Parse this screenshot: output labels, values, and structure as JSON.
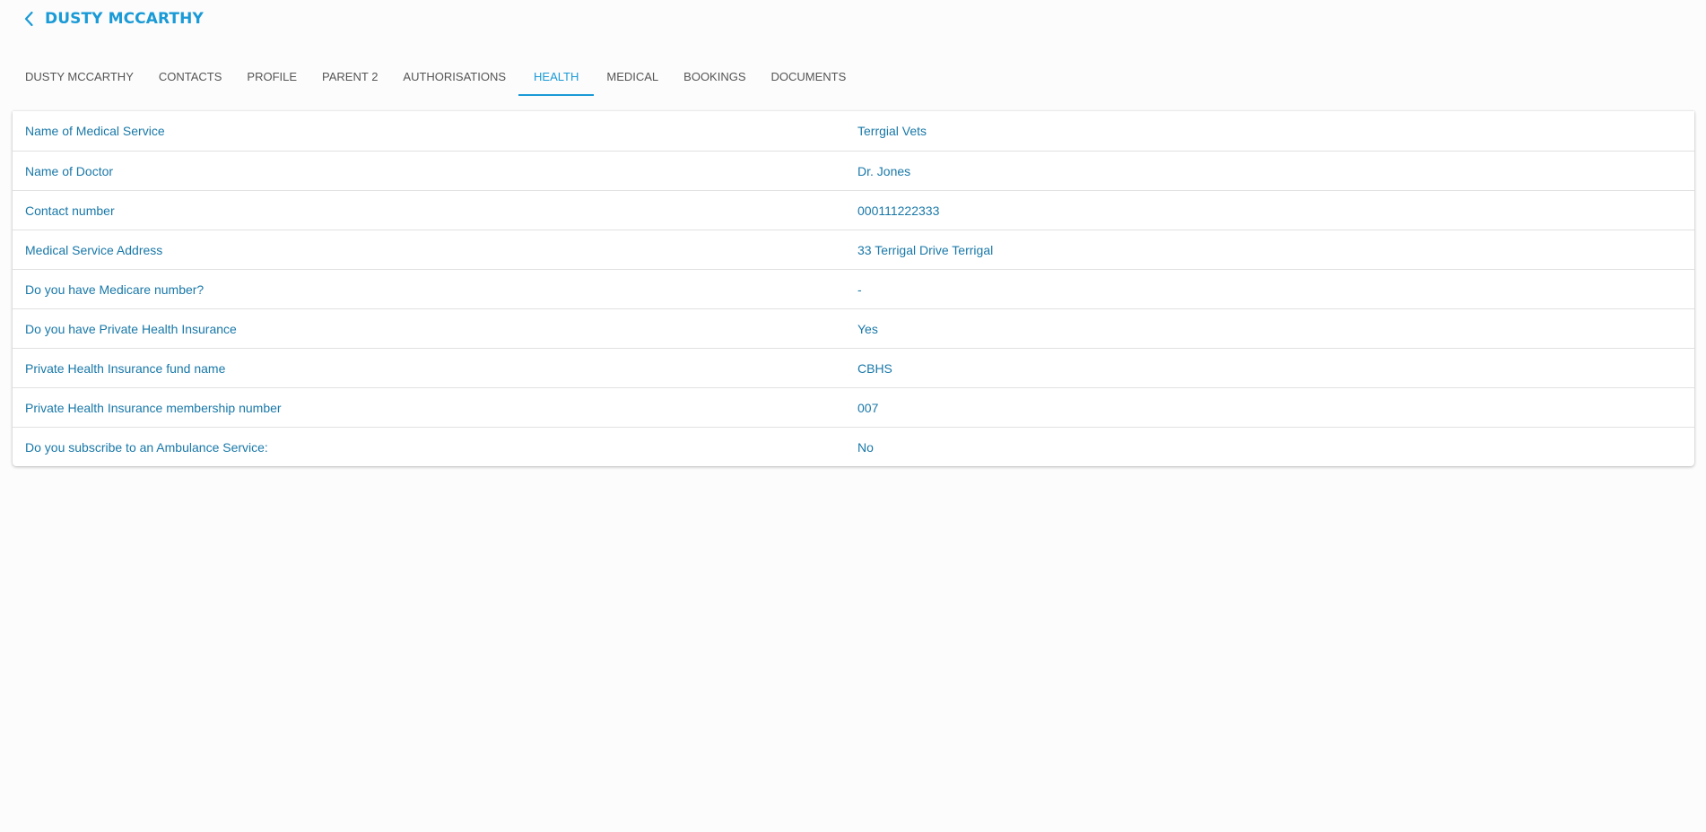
{
  "header": {
    "back_icon": "chevron-left-icon",
    "title": "DUSTY MCCARTHY"
  },
  "tabs": [
    {
      "label": "DUSTY MCCARTHY",
      "active": false
    },
    {
      "label": "CONTACTS",
      "active": false
    },
    {
      "label": "PROFILE",
      "active": false
    },
    {
      "label": "PARENT 2",
      "active": false
    },
    {
      "label": "AUTHORISATIONS",
      "active": false
    },
    {
      "label": "HEALTH",
      "active": true
    },
    {
      "label": "MEDICAL",
      "active": false
    },
    {
      "label": "BOOKINGS",
      "active": false
    },
    {
      "label": "DOCUMENTS",
      "active": false
    }
  ],
  "health": {
    "rows": [
      {
        "label": "Name of Medical Service",
        "value": "Terrgial Vets"
      },
      {
        "label": "Name of Doctor",
        "value": "Dr. Jones"
      },
      {
        "label": "Contact number",
        "value": "000111222333"
      },
      {
        "label": "Medical Service Address",
        "value": "33 Terrigal Drive Terrigal"
      },
      {
        "label": "Do you have Medicare number?",
        "value": "-"
      },
      {
        "label": "Do you have Private Health Insurance",
        "value": "Yes"
      },
      {
        "label": "Private Health Insurance fund name",
        "value": "CBHS"
      },
      {
        "label": "Private Health Insurance membership number",
        "value": "007"
      },
      {
        "label": "Do you subscribe to an Ambulance Service:",
        "value": "No"
      }
    ]
  },
  "colors": {
    "accent": "#1a9ad6",
    "text": "#1978a8",
    "tab_text": "#555555",
    "background": "#fcfcfc"
  }
}
